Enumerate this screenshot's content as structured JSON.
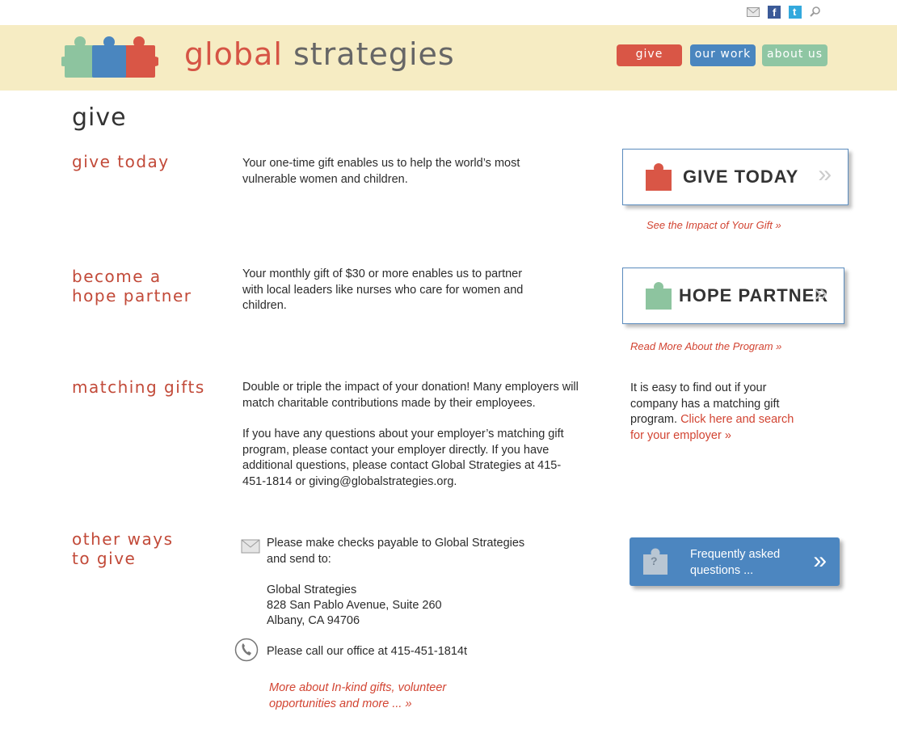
{
  "util": {
    "icons": [
      "mail-icon",
      "facebook-icon",
      "twitter-icon",
      "search-icon"
    ],
    "fb_glyph": "f",
    "tw_glyph": "t"
  },
  "header": {
    "logo_word1": "global",
    "logo_word2": " strategies",
    "nav": {
      "give": "give",
      "our_work": "our work",
      "about_us": "about us"
    }
  },
  "page_title": "give",
  "sections": {
    "give_today": {
      "heading": "give today",
      "text": "Your one-time gift enables us to help the world’s most vulnerable women and children.",
      "button_label": "GIVE TODAY",
      "link": "See the Impact of Your Gift »"
    },
    "hope_partner": {
      "heading": "become a\nhope partner",
      "text": "Your monthly gift of $30 or more enables us to partner with local leaders like nurses who care for women and children.",
      "button_label": "HOPE PARTNER",
      "link": "Read More About the Program »"
    },
    "matching": {
      "heading": "matching gifts",
      "text1": "Double or triple the impact of your donation! Many employers will match charitable contributions made by their employees.",
      "text2": "If you have any questions about your employer’s matching gift program, please contact your employer directly. If you have additional questions, please contact Global Strategies at 415-451-1814 or giving@globalstrategies.org.",
      "side_text": "It is easy to  find out if your company has a matching gift program. ",
      "side_link": "Click here and search for your employer »"
    },
    "other": {
      "heading": "other ways\nto give",
      "checks": "Please make checks payable to Global Strategies and send to:",
      "address1": "Global Strategies",
      "address2": "828 San Pablo Avenue, Suite 260",
      "address3": "Albany, CA 94706",
      "call": "Please call our office at 415-451-1814t",
      "link": "More about In-kind gifts, volunteer opportunities and more ... »",
      "faq_text": "Frequently asked questions ...",
      "faq_arrow": "»",
      "faq_icon_glyph": "?"
    }
  },
  "arrow": "»",
  "colors": {
    "red": "#d95646",
    "blue": "#4a86bf",
    "green": "#8fc6a3",
    "cream": "#f6ecc3"
  }
}
